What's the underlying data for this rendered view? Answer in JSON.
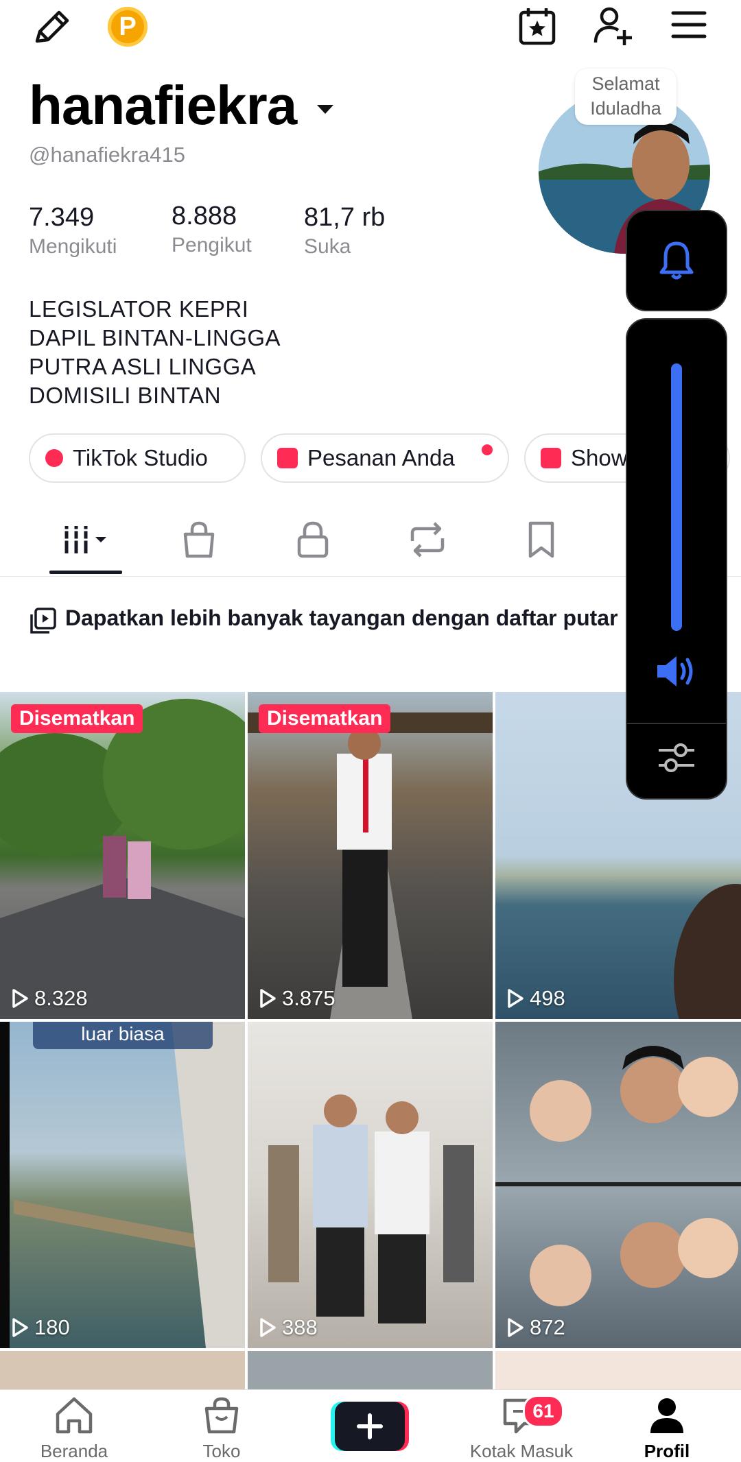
{
  "profile": {
    "username": "hanafiekra",
    "handle": "@hanafiekra415",
    "avatar_note": "Selamat\nIduladha",
    "stats": [
      {
        "value": "7.349",
        "label": "Mengikuti"
      },
      {
        "value": "8.888",
        "label": "Pengikut"
      },
      {
        "value": "81,7 rb",
        "label": "Suka"
      }
    ],
    "bio": [
      "LEGISLATOR KEPRI",
      "DAPIL BINTAN-LINGGA",
      "PUTRA ASLI LINGGA",
      "DOMISILI BINTAN"
    ]
  },
  "pills": [
    {
      "label": "TikTok Studio"
    },
    {
      "label": "Pesanan Anda"
    },
    {
      "label": "Show"
    }
  ],
  "banner": {
    "text": "Dapatkan lebih banyak tayangan dengan daftar putar"
  },
  "videos": [
    {
      "pinned": "Disematkan",
      "views": "8.328"
    },
    {
      "pinned": "Disematkan",
      "views": "3.875"
    },
    {
      "views": "498"
    },
    {
      "caption": "luar biasa",
      "views": "180"
    },
    {
      "views": "388"
    },
    {
      "views": "872"
    }
  ],
  "volume": {
    "level": 1.0
  },
  "bottom_nav": {
    "items": [
      {
        "label": "Beranda"
      },
      {
        "label": "Toko"
      },
      {
        "label": ""
      },
      {
        "label": "Kotak Masuk"
      },
      {
        "label": "Profil"
      }
    ],
    "inbox_badge": "61"
  },
  "coin_letter": "P",
  "colors": {
    "accent": "#fe2c55",
    "volume": "#3d6ff5"
  }
}
